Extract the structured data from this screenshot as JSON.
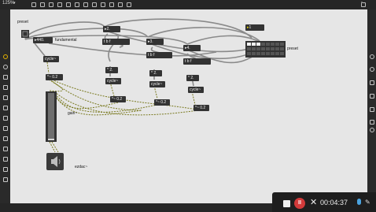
{
  "toolbar": {
    "zoom": "125%"
  },
  "patch": {
    "comment_preset_left": "preset",
    "comment_fundamental": "fundamental",
    "comment_preset_right": "preset",
    "comment_gain": "gain~",
    "comment_ezdac": "ezdac~",
    "number_fundamental": "440.",
    "msg_2": "2.",
    "msg_3": "3.",
    "msg_4": "4.",
    "msg_1": "1",
    "tbf": "t b f",
    "cycle": "cycle~",
    "mul_02": "*~ 0.2",
    "mul_2": "* 2.",
    "mul_3": "* 2.",
    "mul_4": "* 2."
  },
  "recorder": {
    "time": "00:04:37"
  },
  "colors": {
    "canvas": "#e6e6e6",
    "object": "#333333",
    "cord": "#8a8a8a",
    "signal_cord": "#8a8a2a",
    "record": "#d23a3a",
    "mic": "#4aa3e0"
  },
  "icons": [
    "stop-icon",
    "pause-icon",
    "close-icon",
    "mic-icon",
    "pen-icon"
  ]
}
